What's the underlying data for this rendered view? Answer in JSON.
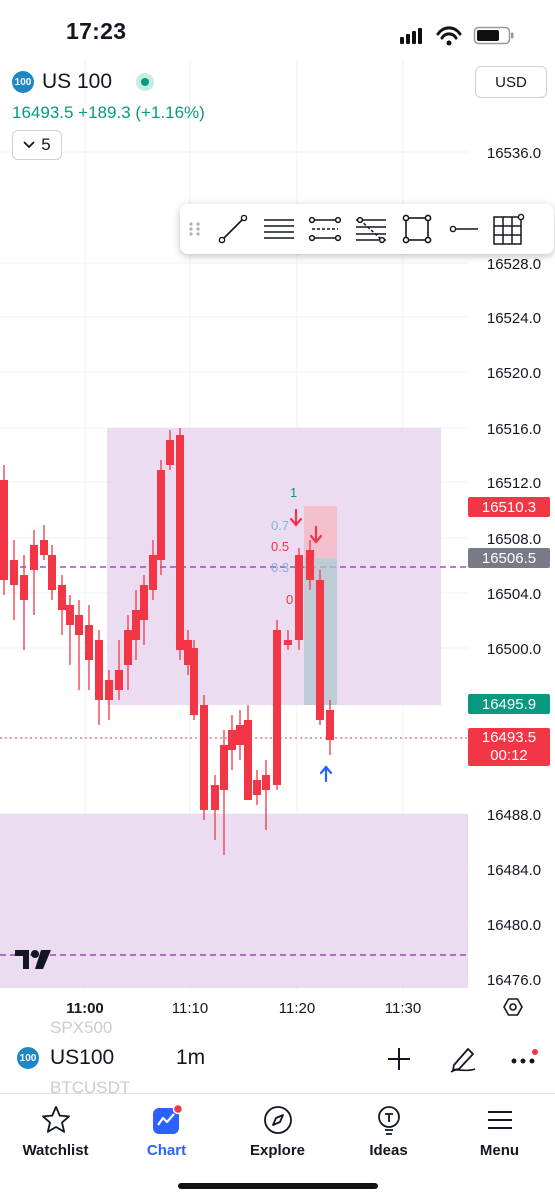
{
  "status_bar": {
    "time": "17:23"
  },
  "header": {
    "symbol_badge": "100",
    "symbol": "US 100",
    "price_line": "16493.5 +189.3 (+1.16%)",
    "interval_value": "5",
    "currency": "USD"
  },
  "chart": {
    "price_axis": [
      "16536.0",
      "16528.0",
      "16524.0",
      "16520.0",
      "16516.0",
      "16512.0",
      "16508.0",
      "16504.0",
      "16500.0",
      "16488.0",
      "16484.0",
      "16480.0",
      "16476.0"
    ],
    "time_axis": [
      "11:00",
      "11:10",
      "11:20",
      "11:30"
    ],
    "tags": {
      "tag1": "16510.3",
      "tag2": "16506.5",
      "tag3": "16495.9",
      "last_price": "16493.5",
      "countdown": "00:12"
    },
    "fib_labels": [
      "1",
      "0.7",
      "0.5",
      "0.3",
      "0"
    ],
    "colors": {
      "up": "#089981",
      "down": "#f23645",
      "zone": "#e8d6f0",
      "tag_gray": "#787b86",
      "alert_arrow": "#2962ff"
    }
  },
  "toolbar": {
    "tools": [
      "drag-handle-icon",
      "trend-line-icon",
      "horizontal-lines-icon",
      "parallel-channel-icon",
      "fib-retracement-icon",
      "rectangle-icon",
      "horizontal-ray-icon",
      "grid-icon"
    ]
  },
  "bottom_bar": {
    "ghost_top": "SPX500",
    "ghost_bottom": "BTCUSDT",
    "symbol_badge": "100",
    "symbol": "US100",
    "timeframe": "1m"
  },
  "nav": {
    "items": [
      {
        "label": "Watchlist",
        "icon": "star-icon"
      },
      {
        "label": "Chart",
        "icon": "chart-icon"
      },
      {
        "label": "Explore",
        "icon": "compass-icon"
      },
      {
        "label": "Ideas",
        "icon": "lightbulb-icon"
      },
      {
        "label": "Menu",
        "icon": "hamburger-menu-icon"
      }
    ]
  }
}
